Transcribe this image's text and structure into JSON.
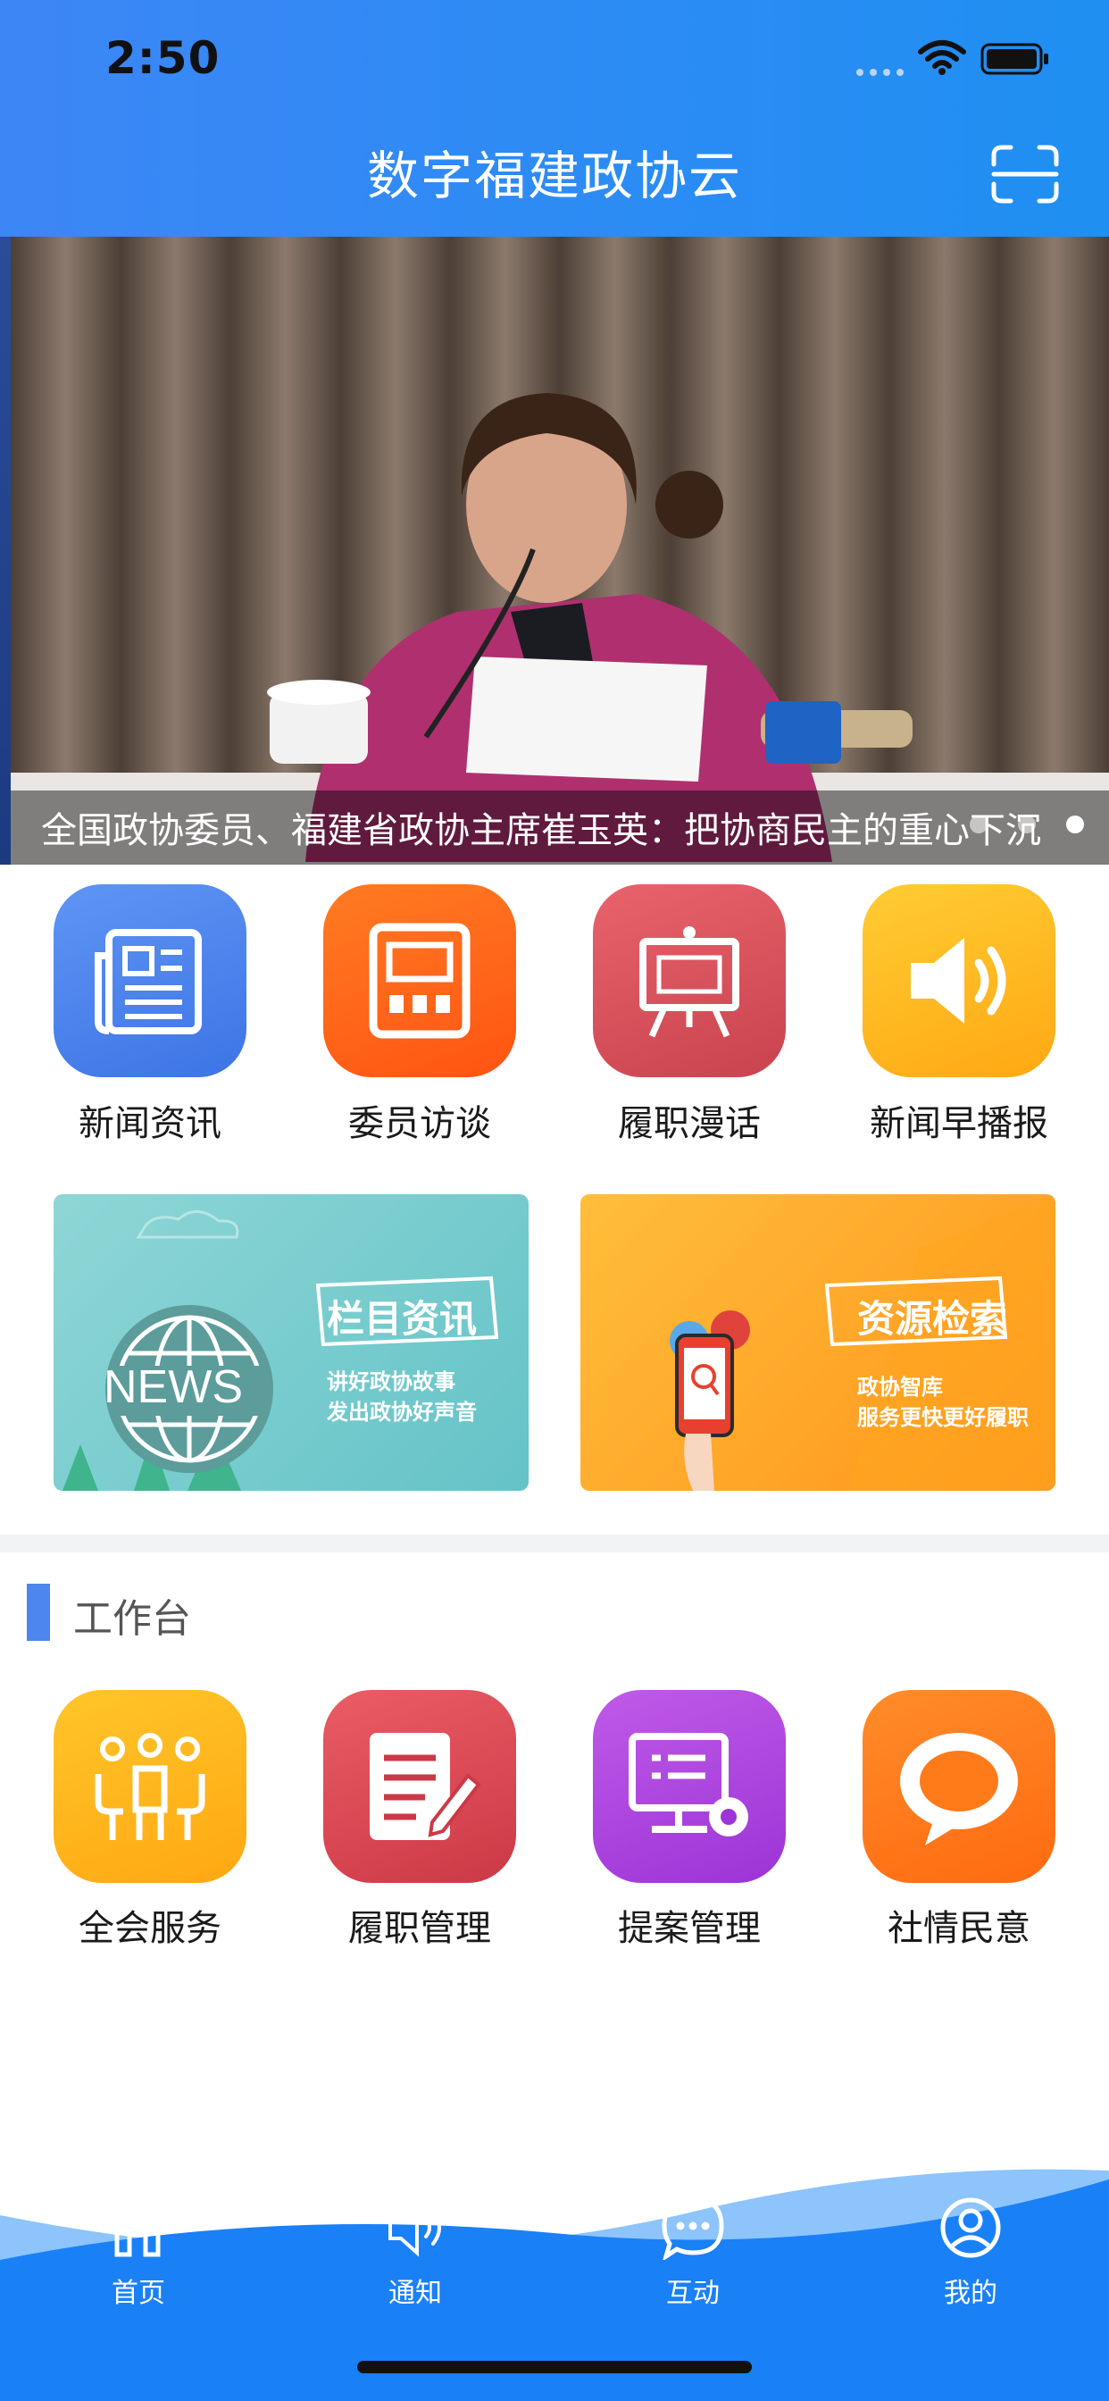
{
  "status_bar": {
    "time": "2:50"
  },
  "header": {
    "title": "数字福建政协云",
    "scan_icon": "scan-icon"
  },
  "banner": {
    "caption": "全国政协委员、福建省政协主席崔玉英：把协商民主的重心下沉",
    "slide_count": 3,
    "active_slide": 1
  },
  "quick_links": [
    {
      "label": "新闻资讯",
      "icon": "newspaper-icon",
      "color": "#4f86ee"
    },
    {
      "label": "委员访谈",
      "icon": "calculator-icon",
      "color": "#ff6a1e"
    },
    {
      "label": "履职漫话",
      "icon": "easel-icon",
      "color": "#d95a66"
    },
    {
      "label": "新闻早播报",
      "icon": "speaker-icon",
      "color": "#ffb81c"
    }
  ],
  "promos": [
    {
      "title": "栏目资讯",
      "line1": "讲好政协故事",
      "line2": "发出政协好声音",
      "badge": "NEWS",
      "color": "#7fcdd0"
    },
    {
      "title": "资源检索",
      "line1": "政协智库",
      "line2": "服务更快更好履职",
      "color": "#ff9e1f"
    }
  ],
  "workbench": {
    "title": "工作台",
    "items": [
      {
        "label": "全会服务",
        "icon": "people-icon",
        "color": "#ffb21a"
      },
      {
        "label": "履职管理",
        "icon": "document-edit-icon",
        "color": "#d94a55"
      },
      {
        "label": "提案管理",
        "icon": "proposal-settings-icon",
        "color": "#b442e0"
      },
      {
        "label": "社情民意",
        "icon": "chat-bubble-icon",
        "color": "#ff7a18"
      }
    ]
  },
  "tabbar": {
    "items": [
      {
        "label": "首页",
        "icon": "home-icon"
      },
      {
        "label": "通知",
        "icon": "speaker-icon"
      },
      {
        "label": "互动",
        "icon": "chat-icon"
      },
      {
        "label": "我的",
        "icon": "user-icon"
      }
    ],
    "accent": "#1a80f6"
  }
}
